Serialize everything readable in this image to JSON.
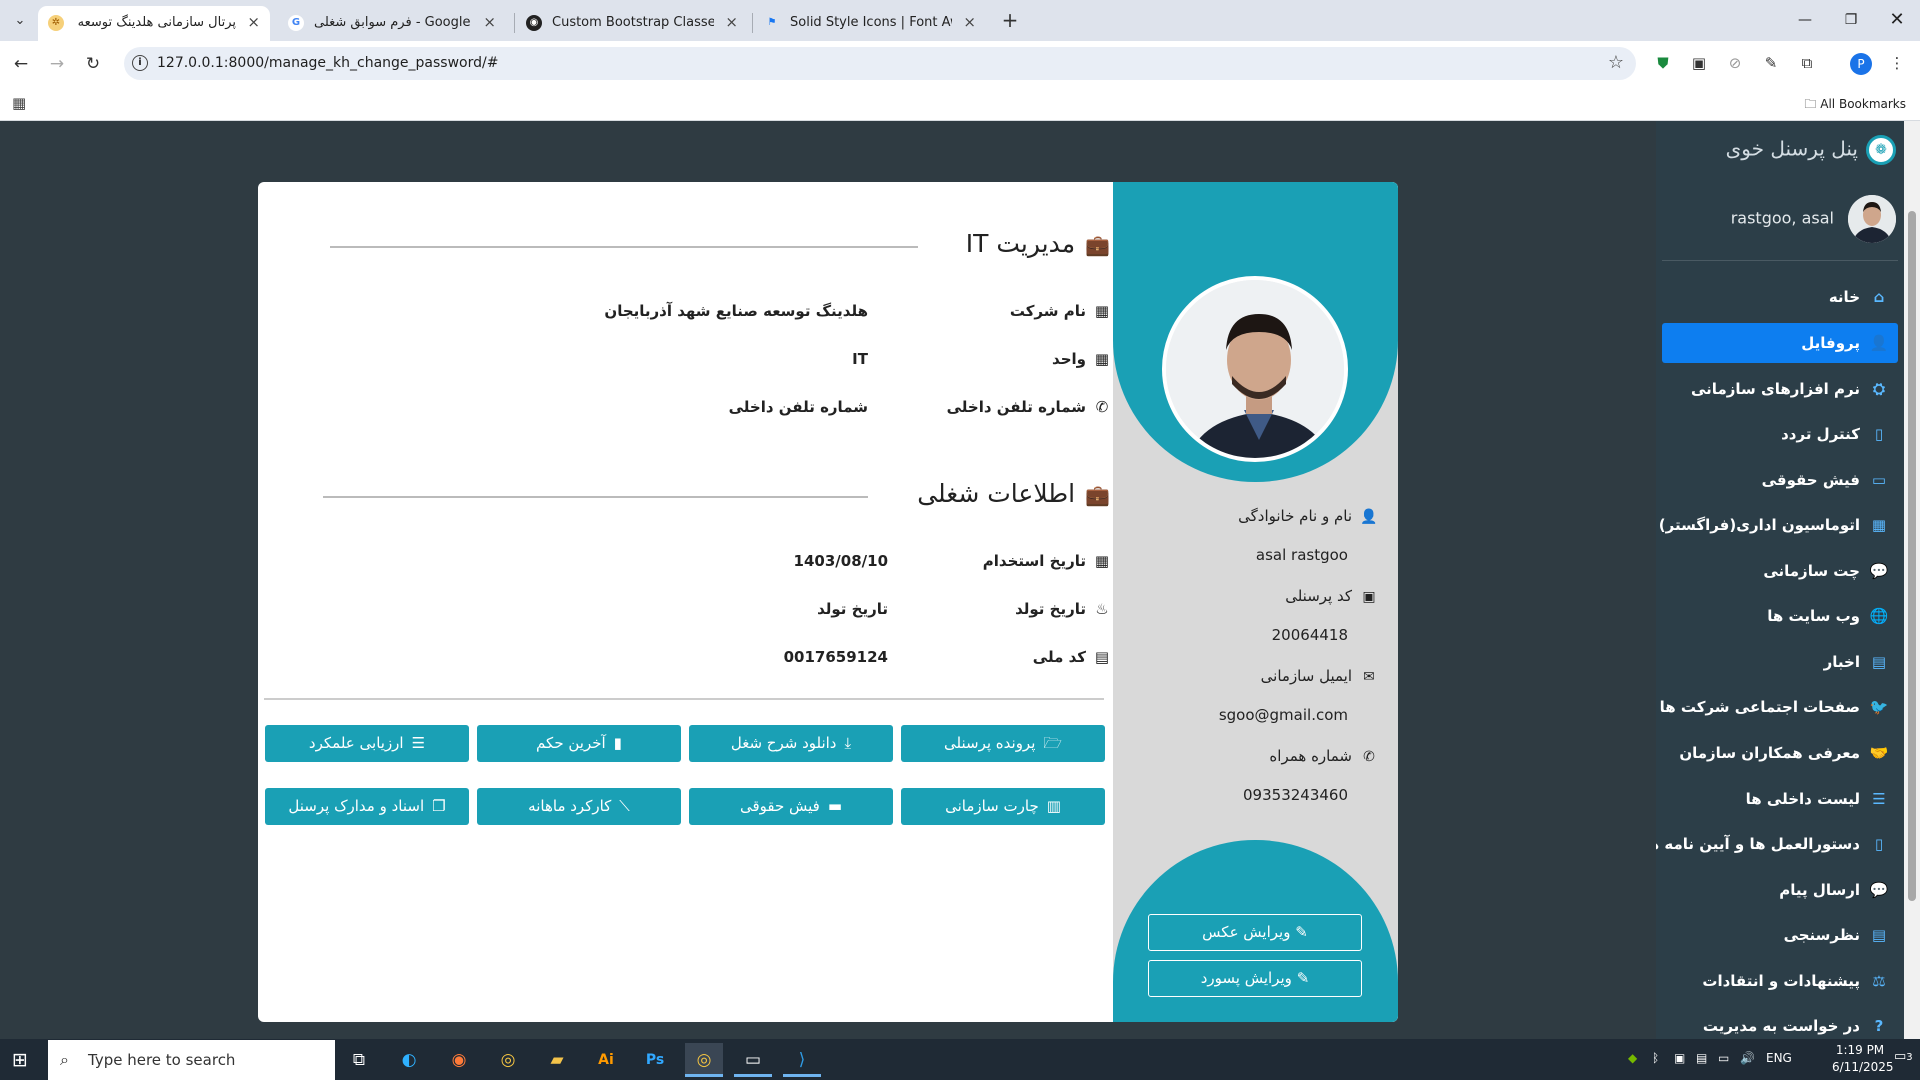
{
  "browser": {
    "tabs": [
      {
        "label": "پرتال سازمانی هلدینگ توسعه صنا",
        "active": true
      },
      {
        "label": "فرم سوابق شغلی - Google Search",
        "active": false
      },
      {
        "label": "Custom Bootstrap Classes",
        "active": false
      },
      {
        "label": "Solid Style Icons | Font Awesome",
        "active": false
      }
    ],
    "url": "127.0.0.1:8000/manage_kh_change_password/#",
    "all_bookmarks": "All Bookmarks",
    "profile_initial": "P"
  },
  "sidebar": {
    "title": "پنل پرسنل خوی",
    "user": "rastgoo, asal",
    "items": [
      {
        "label": "خانه",
        "icon": "home-icon"
      },
      {
        "label": "پروفایل",
        "icon": "user-icon",
        "active": true
      },
      {
        "label": "نرم افزارهای سازمانی",
        "icon": "software-icon"
      },
      {
        "label": "کنترل تردد",
        "icon": "access-control-icon"
      },
      {
        "label": "فیش حقوقی",
        "icon": "payslip-icon"
      },
      {
        "label": "اتوماسیون اداری(فراگستر)",
        "icon": "automation-icon"
      },
      {
        "label": "چت سازمانی",
        "icon": "chat-icon"
      },
      {
        "label": "وب سایت ها",
        "icon": "globe-icon"
      },
      {
        "label": "اخبار",
        "icon": "news-icon"
      },
      {
        "label": "صفحات اجتماعی شرکت ها",
        "icon": "twitter-icon"
      },
      {
        "label": "معرفی همکاران سازمان",
        "icon": "handshake-icon"
      },
      {
        "label": "لیست داخلی ها",
        "icon": "list-icon"
      },
      {
        "label": "دستورالعمل ها و آیین نامه ها",
        "icon": "document-icon"
      },
      {
        "label": "ارسال پیام",
        "icon": "message-icon"
      },
      {
        "label": "نظرسنجی",
        "icon": "poll-icon"
      },
      {
        "label": "پیشنهادات و انتقادات",
        "icon": "feedback-icon"
      },
      {
        "label": "در خواست به مدیریت",
        "icon": "question-icon"
      }
    ]
  },
  "profile": {
    "name_label": "نام و نام خانوادگی",
    "name_value": "asal rastgoo",
    "code_label": "کد پرسنلی",
    "code_value": "20064418",
    "email_label": "ایمیل سازمانی",
    "email_value": "sgoo@gmail.com",
    "phone_label": "شماره همراه",
    "phone_value": "09353243460",
    "edit_photo": "ویرایش عکس",
    "edit_password": "ویرایش پسورد"
  },
  "org": {
    "heading": "مدیریت IT",
    "company_label": "نام شرکت",
    "company_value": "هلدینگ توسعه صنایع شهد آذربایجان",
    "unit_label": "واحد",
    "unit_value": "IT",
    "ext_label": "شماره تلفن داخلی",
    "ext_value": "شماره تلفن داخلی"
  },
  "job": {
    "heading": "اطلاعات شغلی",
    "hire_label": "تاریخ استخدام",
    "hire_value": "1403/08/10",
    "birth_label": "تاریخ تولد",
    "birth_value": "تاریخ تولد",
    "national_label": "کد ملی",
    "national_value": "0017659124"
  },
  "actions": [
    "پرونده پرسنلی",
    "دانلود شرح شغل",
    "آخرین حکم",
    "ارزیابی علمکرد",
    "چارت سازمانی",
    "فیش حقوقی",
    "کارکرد ماهانه",
    "اسناد و مدارک پرسنل"
  ],
  "taskbar": {
    "search_placeholder": "Type here to search",
    "lang": "ENG",
    "time": "1:19 PM",
    "date": "6/11/2025",
    "notif": "3"
  }
}
